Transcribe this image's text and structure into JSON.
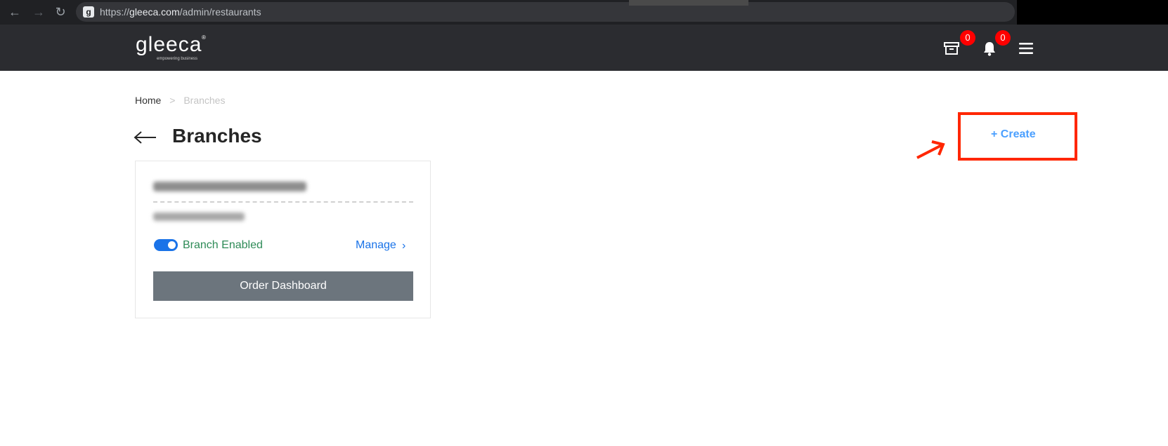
{
  "browser": {
    "url_prefix": "https://",
    "url_domain": "gleeca.com",
    "url_path": "/admin/restaurants",
    "favicon": "g"
  },
  "header": {
    "logo": "gleeca",
    "logo_tagline": "empowering business",
    "logo_mark": "®",
    "archive_count": "0",
    "notification_count": "0"
  },
  "breadcrumb": {
    "home": "Home",
    "separator": ">",
    "current": "Branches"
  },
  "page": {
    "title": "Branches",
    "create_label": "+ Create"
  },
  "branch_card": {
    "status_label": "Branch Enabled",
    "manage_label": "Manage",
    "manage_chevron": "›",
    "order_dashboard_label": "Order Dashboard",
    "enabled": true
  },
  "colors": {
    "accent": "#1a73e8",
    "enabled_green": "#2e8b57",
    "badge_red": "#ff0000",
    "highlight_red": "#ff2600",
    "header_bg": "#2b2c30"
  }
}
